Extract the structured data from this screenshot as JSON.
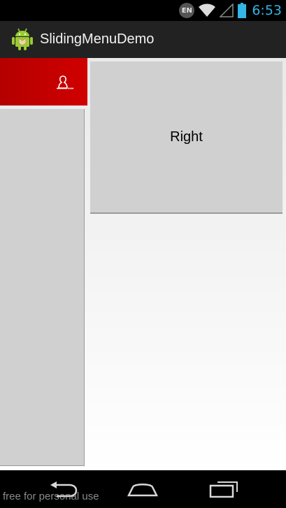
{
  "status_bar": {
    "language": "EN",
    "time": "6:53",
    "icons": [
      "wifi-icon",
      "signal-icon",
      "battery-icon"
    ]
  },
  "action_bar": {
    "title": "SlidingMenuDemo",
    "app_icon": "android-robot-icon"
  },
  "left_panel": {
    "header_color": "#c80000",
    "header_icon": "user-icon"
  },
  "right_panel": {
    "label": "Right"
  },
  "nav_bar": {
    "buttons": [
      "back",
      "home",
      "recent-apps"
    ]
  },
  "watermark": "free for personal use",
  "colors": {
    "accent": "#33b5e5",
    "red_header": "#c80000",
    "card": "#d0d0d0"
  }
}
